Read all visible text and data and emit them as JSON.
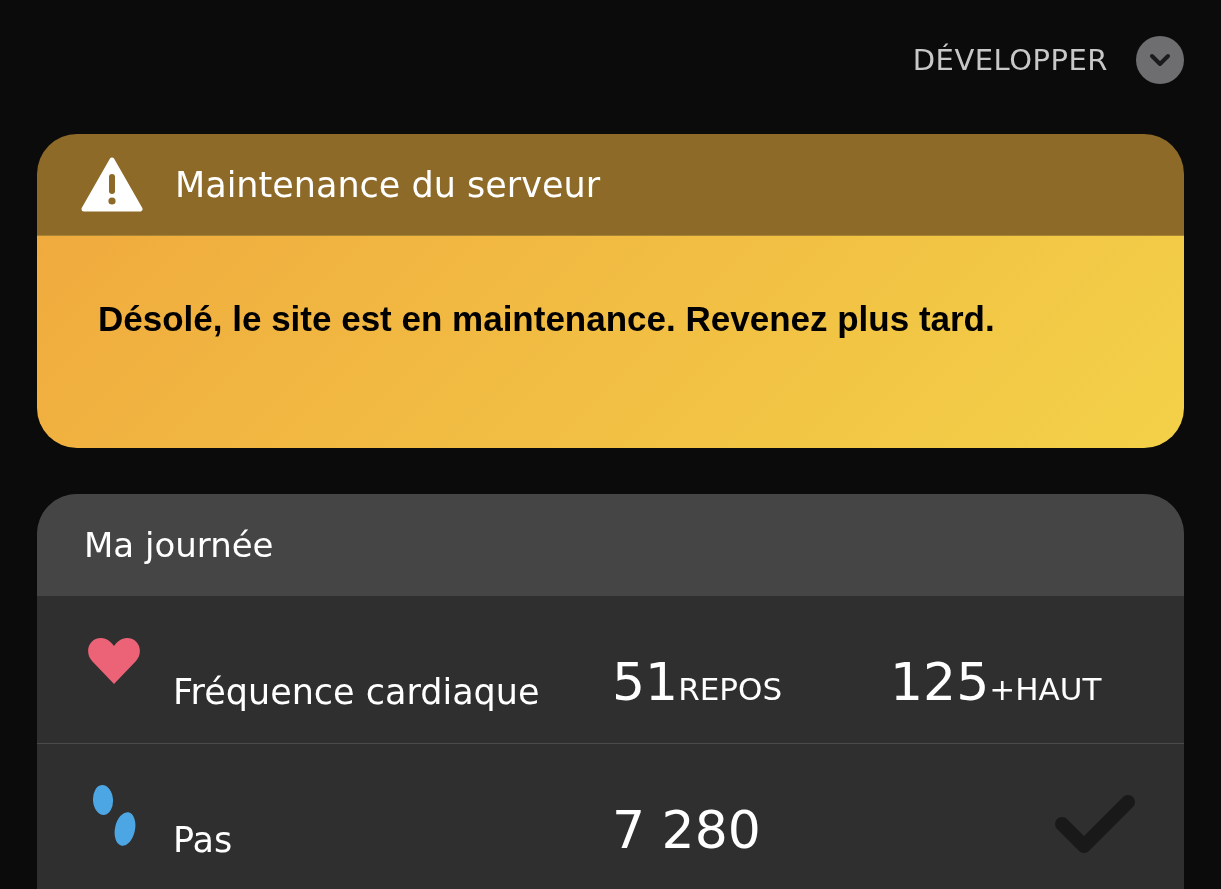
{
  "header": {
    "expand_label": "DÉVELOPPER"
  },
  "alert": {
    "title": "Maintenance du serveur",
    "message": "Désolé, le site est en maintenance. Revenez plus tard."
  },
  "day_card": {
    "title": "Ma journée",
    "rows": [
      {
        "kind": "heart",
        "label": "Fréquence cardiaque",
        "metrics": [
          {
            "value": "51",
            "unit": "REPOS"
          },
          {
            "value": "125",
            "unit": "+HAUT"
          }
        ]
      },
      {
        "kind": "steps",
        "label": "Pas",
        "metrics": [
          {
            "value": "7 280"
          }
        ],
        "goal_met": false
      }
    ]
  }
}
